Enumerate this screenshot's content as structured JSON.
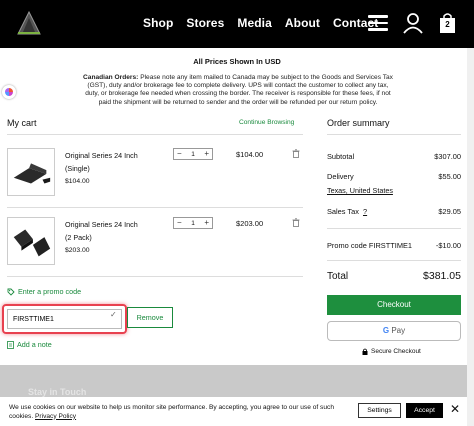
{
  "header": {
    "logo_icon": "triangle-logo",
    "nav": [
      "Shop",
      "Stores",
      "Media",
      "About",
      "Contact"
    ],
    "cart_count": "2"
  },
  "notice": {
    "title": "All Prices Shown In USD",
    "bold": "Canadian Orders:",
    "text": " Please note any item mailed to Canada may be subject to the Goods and Services Tax (GST), duty and/or brokerage fee to complete delivery. UPS will contact the customer to collect any tax, duty, or brokerage fee needed when crossing the border. The receiver is responsible for these fees, if not paid the shipment will be returned to sender and the order will be refunded per our return policy."
  },
  "cart": {
    "title": "My cart",
    "continue": "Continue Browsing",
    "items": [
      {
        "name": "Original Series 24 Inch (Single)",
        "price": "$104.00",
        "qty": "1",
        "total": "$104.00"
      },
      {
        "name": "Original Series 24 Inch (2 Pack)",
        "price": "$203.00",
        "qty": "1",
        "total": "$203.00"
      }
    ],
    "promo_link": "Enter a promo code",
    "promo_value": "FIRSTTIME1",
    "remove": "Remove",
    "add_note": "Add a note"
  },
  "summary": {
    "title": "Order summary",
    "subtotal_label": "Subtotal",
    "subtotal": "$307.00",
    "delivery_label": "Delivery",
    "delivery": "$55.00",
    "address": "Texas, United States",
    "tax_label": "Sales Tax",
    "tax_help": "?",
    "tax": "$29.05",
    "promo_label": "Promo code FIRSTTIME1",
    "promo": "-$10.00",
    "total_label": "Total",
    "total": "$381.05",
    "checkout": "Checkout",
    "gpay_g": "G",
    "gpay": " Pay",
    "secure": "Secure Checkout"
  },
  "footer": {
    "partial_text": "Stay in Touch"
  },
  "cookie": {
    "text": "We use cookies on our website to help us monitor site performance. By accepting, you agree to our use of such cookies. ",
    "policy": "Privacy Policy",
    "settings": "Settings",
    "accept": "Accept",
    "close": "✕"
  },
  "colors": {
    "accent": "#1a8a3d",
    "checkout": "#1e8f3e",
    "highlight": "#e8414f"
  }
}
